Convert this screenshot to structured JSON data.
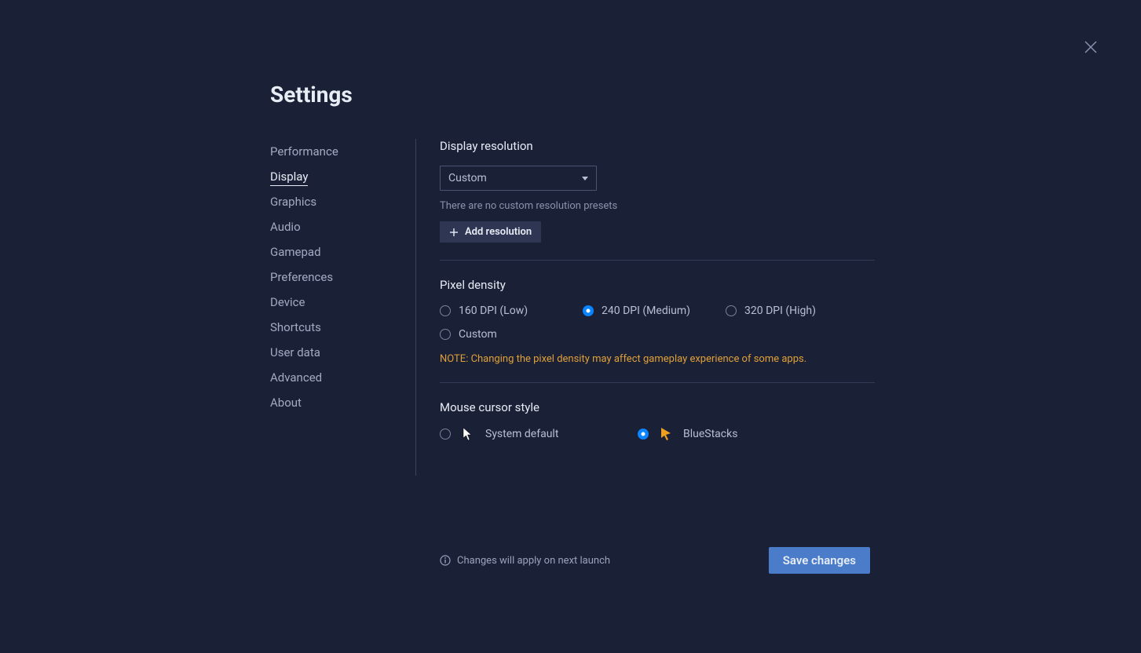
{
  "page_title": "Settings",
  "sidebar": {
    "items": [
      {
        "label": "Performance"
      },
      {
        "label": "Display"
      },
      {
        "label": "Graphics"
      },
      {
        "label": "Audio"
      },
      {
        "label": "Gamepad"
      },
      {
        "label": "Preferences"
      },
      {
        "label": "Device"
      },
      {
        "label": "Shortcuts"
      },
      {
        "label": "User data"
      },
      {
        "label": "Advanced"
      },
      {
        "label": "About"
      }
    ],
    "active_index": 1
  },
  "display_resolution": {
    "label": "Display resolution",
    "selected": "Custom",
    "hint": "There are no custom resolution presets",
    "add_button_label": "Add resolution"
  },
  "pixel_density": {
    "label": "Pixel density",
    "options": [
      {
        "label": "160 DPI (Low)",
        "selected": false
      },
      {
        "label": "240 DPI (Medium)",
        "selected": true
      },
      {
        "label": "320 DPI (High)",
        "selected": false
      },
      {
        "label": "Custom",
        "selected": false
      }
    ],
    "note": "NOTE: Changing the pixel density may affect gameplay experience of some apps."
  },
  "mouse_cursor": {
    "label": "Mouse cursor style",
    "options": [
      {
        "label": "System default",
        "selected": false
      },
      {
        "label": "BlueStacks",
        "selected": true
      }
    ]
  },
  "footer": {
    "note": "Changes will apply on next launch",
    "save_label": "Save changes"
  }
}
